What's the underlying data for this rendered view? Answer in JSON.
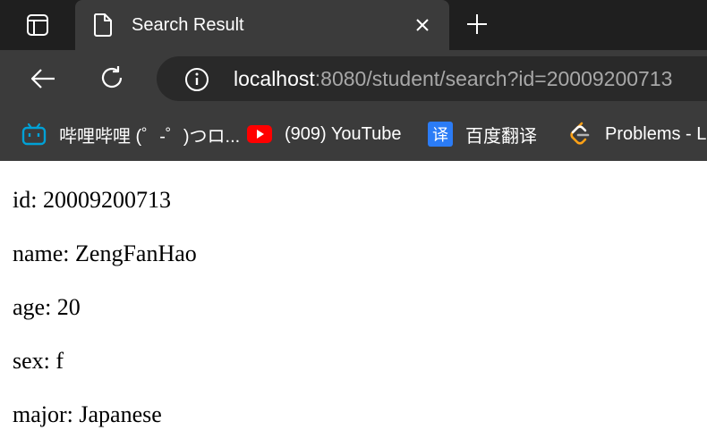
{
  "browser": {
    "tab": {
      "title": "Search Result"
    },
    "address": {
      "host": "localhost",
      "rest": ":8080/student/search?id=20009200713"
    },
    "bookmarks": [
      {
        "label": "哔哩哔哩 (゜-゜)つロ...",
        "icon": "bilibili-icon",
        "color": "#00a1d6"
      },
      {
        "label": "(909) YouTube",
        "icon": "youtube-icon",
        "color": "#ff0000"
      },
      {
        "label": "百度翻译",
        "icon": "translate-icon",
        "color": "#2b7cf6"
      },
      {
        "label": "Problems - L",
        "icon": "leetcode-icon",
        "color": "#ffa116"
      }
    ]
  },
  "student": [
    {
      "text": "id: 20009200713"
    },
    {
      "text": "name: ZengFanHao"
    },
    {
      "text": "age: 20"
    },
    {
      "text": "sex: f"
    },
    {
      "text": "major: Japanese"
    }
  ]
}
